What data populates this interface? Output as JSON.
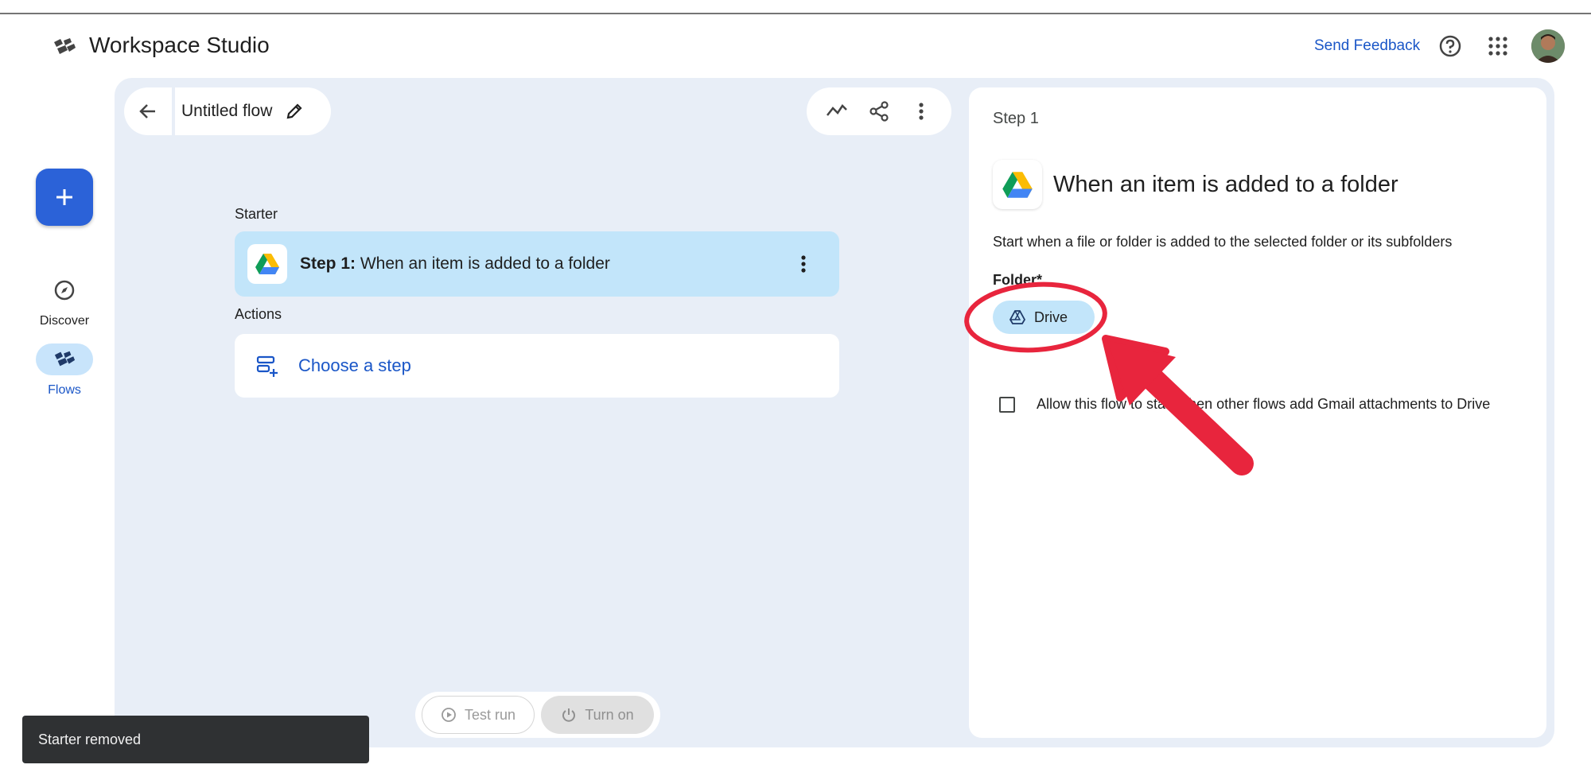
{
  "app": {
    "title": "Workspace Studio",
    "logo_icon": "flows-logo-icon"
  },
  "header": {
    "send_feedback": "Send Feedback",
    "help_icon": "help-circle-icon",
    "apps_icon": "apps-grid-icon"
  },
  "nav": {
    "create_icon": "plus-icon",
    "items": [
      {
        "label": "Discover",
        "icon": "compass-icon",
        "active": false
      },
      {
        "label": "Flows",
        "icon": "flows-icon",
        "active": true
      }
    ]
  },
  "flow": {
    "title": "Untitled flow"
  },
  "toolbar": {
    "icons": [
      "activity-icon",
      "share-icon",
      "more-vert-icon"
    ]
  },
  "canvas": {
    "starter_label": "Starter",
    "step_prefix": "Step 1:",
    "step_text": "When an item is added to a folder",
    "actions_label": "Actions",
    "choose_step": "Choose a step",
    "test_run": "Test run",
    "turn_on": "Turn on"
  },
  "panel": {
    "step_label": "Step 1",
    "title": "When an item is added to a folder",
    "description": "Start when a file or folder is added to the selected folder or its subfolders",
    "folder_label": "Folder*",
    "drive_chip": "Drive",
    "checkbox_label": "Allow this flow to start when other flows add Gmail attachments to Drive",
    "checkbox_checked": false
  },
  "snackbar": {
    "message": "Starter removed"
  },
  "colors": {
    "accent": "#2b62d8",
    "link": "#1a56c7",
    "selected": "#c2e5fa",
    "canvas": "#e8eef7",
    "annotation": "#e8253d"
  }
}
